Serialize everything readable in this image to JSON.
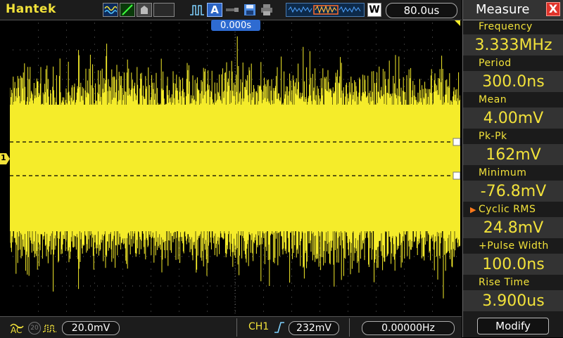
{
  "brand": "Hantek",
  "topbar": {
    "icons": [
      "waveform-mode-icon",
      "trigger-slope-icon",
      "persist-icon",
      "blank-slot",
      "pulse-trigger-icon",
      "auto-icon",
      "probe-icon",
      "save-icon",
      "print-icon",
      "memory-depth-icon",
      "wave-window-icon"
    ],
    "auto_label": "A",
    "window_label": "W",
    "timebase": "80.0us"
  },
  "trigger_position": "0.000s",
  "channel_marker": "1",
  "bottombar": {
    "coupling": "AC",
    "bandwidth_icon": "20",
    "volts_per_div": "20.0mV",
    "trigger_channel": "CH1",
    "trigger_level": "232mV",
    "frequency_counter": "0.00000Hz"
  },
  "measure": {
    "title": "Measure",
    "close": "X",
    "selected_index": 5,
    "items": [
      {
        "label": "Frequency",
        "value": "3.333MHz"
      },
      {
        "label": "Period",
        "value": "300.0ns"
      },
      {
        "label": "Mean",
        "value": "4.00mV"
      },
      {
        "label": "Pk-Pk",
        "value": "162mV"
      },
      {
        "label": "Minimum",
        "value": "-76.8mV"
      },
      {
        "label": "Cyclic RMS",
        "value": "24.8mV"
      },
      {
        "label": "+Pulse Width",
        "value": "100.0ns"
      },
      {
        "label": "Rise Time",
        "value": "3.900us"
      }
    ],
    "modify": "Modify"
  },
  "colors": {
    "trace": "#f5ec2a",
    "grid": "#6a6a6a",
    "accent": "#f2e23a",
    "trigger_marker": "#2e6bd1",
    "selected": "#ff7a1a",
    "close_button": "#e0342b"
  }
}
